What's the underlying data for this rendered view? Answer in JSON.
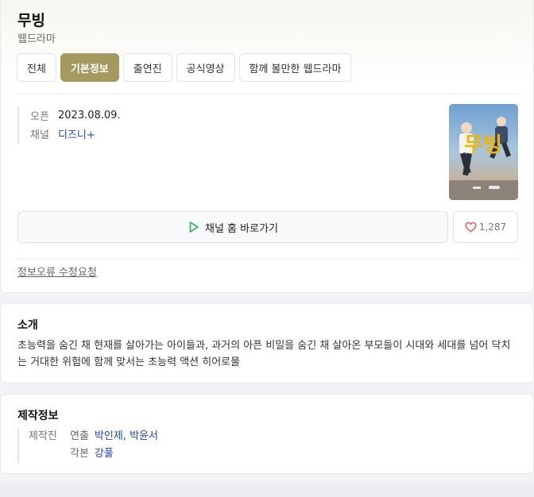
{
  "header": {
    "title": "무빙",
    "subtitle": "웹드라마"
  },
  "tabs": [
    {
      "label": "전체"
    },
    {
      "label": "기본정보"
    },
    {
      "label": "출연진"
    },
    {
      "label": "공식영상"
    },
    {
      "label": "함께 볼만한 웹드라마"
    }
  ],
  "info": {
    "open_label": "오픈",
    "open_value": "2023.08.09.",
    "channel_label": "채널",
    "channel_value": "디즈니+"
  },
  "poster": {
    "title_text": "무빙",
    "icon": "poster-image"
  },
  "channel_button": {
    "label": "채널 홈 바로가기",
    "icon": "play-icon"
  },
  "like_button": {
    "count": "1,287",
    "icon": "heart-icon"
  },
  "report_link": "정보오류 수정요청",
  "intro": {
    "title": "소개",
    "text": "초능력을 숨긴 채 현재를 살아가는 아이들과, 과거의 아픈 비밀을 숨긴 채 살아온 부모들이 시대와 세대를 넘어 닥치는 거대한 위험에 함께 맞서는 초능력 액션 히어로물"
  },
  "production": {
    "title": "제작정보",
    "label": "제작진",
    "director_role": "연출",
    "director_names": "박인제, 박윤서",
    "writer_role": "각본",
    "writer_names": "강풀"
  },
  "colors": {
    "accent": "#a29a5f",
    "link": "#2348a8",
    "play_green": "#22b14c",
    "heart_red": "#e04848"
  }
}
